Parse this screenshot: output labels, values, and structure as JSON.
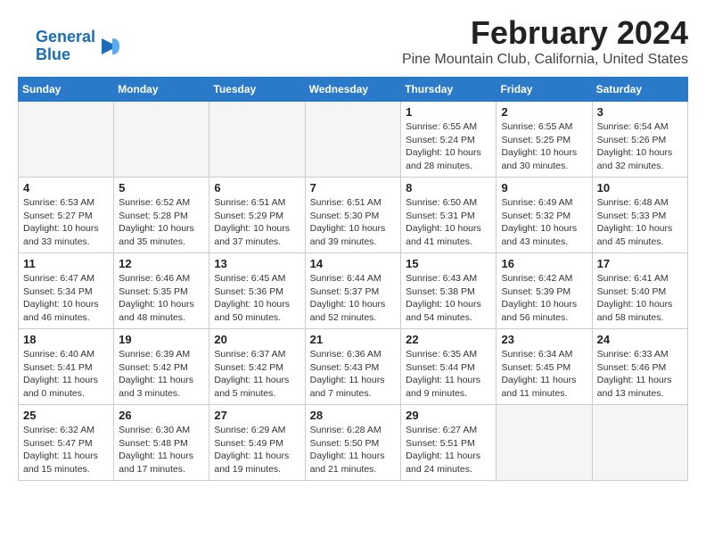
{
  "header": {
    "month_title": "February 2024",
    "location": "Pine Mountain Club, California, United States",
    "logo_line1": "General",
    "logo_line2": "Blue"
  },
  "days_of_week": [
    "Sunday",
    "Monday",
    "Tuesday",
    "Wednesday",
    "Thursday",
    "Friday",
    "Saturday"
  ],
  "weeks": [
    [
      {
        "day": "",
        "content": ""
      },
      {
        "day": "",
        "content": ""
      },
      {
        "day": "",
        "content": ""
      },
      {
        "day": "",
        "content": ""
      },
      {
        "day": "1",
        "content": "Sunrise: 6:55 AM\nSunset: 5:24 PM\nDaylight: 10 hours\nand 28 minutes."
      },
      {
        "day": "2",
        "content": "Sunrise: 6:55 AM\nSunset: 5:25 PM\nDaylight: 10 hours\nand 30 minutes."
      },
      {
        "day": "3",
        "content": "Sunrise: 6:54 AM\nSunset: 5:26 PM\nDaylight: 10 hours\nand 32 minutes."
      }
    ],
    [
      {
        "day": "4",
        "content": "Sunrise: 6:53 AM\nSunset: 5:27 PM\nDaylight: 10 hours\nand 33 minutes."
      },
      {
        "day": "5",
        "content": "Sunrise: 6:52 AM\nSunset: 5:28 PM\nDaylight: 10 hours\nand 35 minutes."
      },
      {
        "day": "6",
        "content": "Sunrise: 6:51 AM\nSunset: 5:29 PM\nDaylight: 10 hours\nand 37 minutes."
      },
      {
        "day": "7",
        "content": "Sunrise: 6:51 AM\nSunset: 5:30 PM\nDaylight: 10 hours\nand 39 minutes."
      },
      {
        "day": "8",
        "content": "Sunrise: 6:50 AM\nSunset: 5:31 PM\nDaylight: 10 hours\nand 41 minutes."
      },
      {
        "day": "9",
        "content": "Sunrise: 6:49 AM\nSunset: 5:32 PM\nDaylight: 10 hours\nand 43 minutes."
      },
      {
        "day": "10",
        "content": "Sunrise: 6:48 AM\nSunset: 5:33 PM\nDaylight: 10 hours\nand 45 minutes."
      }
    ],
    [
      {
        "day": "11",
        "content": "Sunrise: 6:47 AM\nSunset: 5:34 PM\nDaylight: 10 hours\nand 46 minutes."
      },
      {
        "day": "12",
        "content": "Sunrise: 6:46 AM\nSunset: 5:35 PM\nDaylight: 10 hours\nand 48 minutes."
      },
      {
        "day": "13",
        "content": "Sunrise: 6:45 AM\nSunset: 5:36 PM\nDaylight: 10 hours\nand 50 minutes."
      },
      {
        "day": "14",
        "content": "Sunrise: 6:44 AM\nSunset: 5:37 PM\nDaylight: 10 hours\nand 52 minutes."
      },
      {
        "day": "15",
        "content": "Sunrise: 6:43 AM\nSunset: 5:38 PM\nDaylight: 10 hours\nand 54 minutes."
      },
      {
        "day": "16",
        "content": "Sunrise: 6:42 AM\nSunset: 5:39 PM\nDaylight: 10 hours\nand 56 minutes."
      },
      {
        "day": "17",
        "content": "Sunrise: 6:41 AM\nSunset: 5:40 PM\nDaylight: 10 hours\nand 58 minutes."
      }
    ],
    [
      {
        "day": "18",
        "content": "Sunrise: 6:40 AM\nSunset: 5:41 PM\nDaylight: 11 hours\nand 0 minutes."
      },
      {
        "day": "19",
        "content": "Sunrise: 6:39 AM\nSunset: 5:42 PM\nDaylight: 11 hours\nand 3 minutes."
      },
      {
        "day": "20",
        "content": "Sunrise: 6:37 AM\nSunset: 5:42 PM\nDaylight: 11 hours\nand 5 minutes."
      },
      {
        "day": "21",
        "content": "Sunrise: 6:36 AM\nSunset: 5:43 PM\nDaylight: 11 hours\nand 7 minutes."
      },
      {
        "day": "22",
        "content": "Sunrise: 6:35 AM\nSunset: 5:44 PM\nDaylight: 11 hours\nand 9 minutes."
      },
      {
        "day": "23",
        "content": "Sunrise: 6:34 AM\nSunset: 5:45 PM\nDaylight: 11 hours\nand 11 minutes."
      },
      {
        "day": "24",
        "content": "Sunrise: 6:33 AM\nSunset: 5:46 PM\nDaylight: 11 hours\nand 13 minutes."
      }
    ],
    [
      {
        "day": "25",
        "content": "Sunrise: 6:32 AM\nSunset: 5:47 PM\nDaylight: 11 hours\nand 15 minutes."
      },
      {
        "day": "26",
        "content": "Sunrise: 6:30 AM\nSunset: 5:48 PM\nDaylight: 11 hours\nand 17 minutes."
      },
      {
        "day": "27",
        "content": "Sunrise: 6:29 AM\nSunset: 5:49 PM\nDaylight: 11 hours\nand 19 minutes."
      },
      {
        "day": "28",
        "content": "Sunrise: 6:28 AM\nSunset: 5:50 PM\nDaylight: 11 hours\nand 21 minutes."
      },
      {
        "day": "29",
        "content": "Sunrise: 6:27 AM\nSunset: 5:51 PM\nDaylight: 11 hours\nand 24 minutes."
      },
      {
        "day": "",
        "content": ""
      },
      {
        "day": "",
        "content": ""
      }
    ]
  ]
}
